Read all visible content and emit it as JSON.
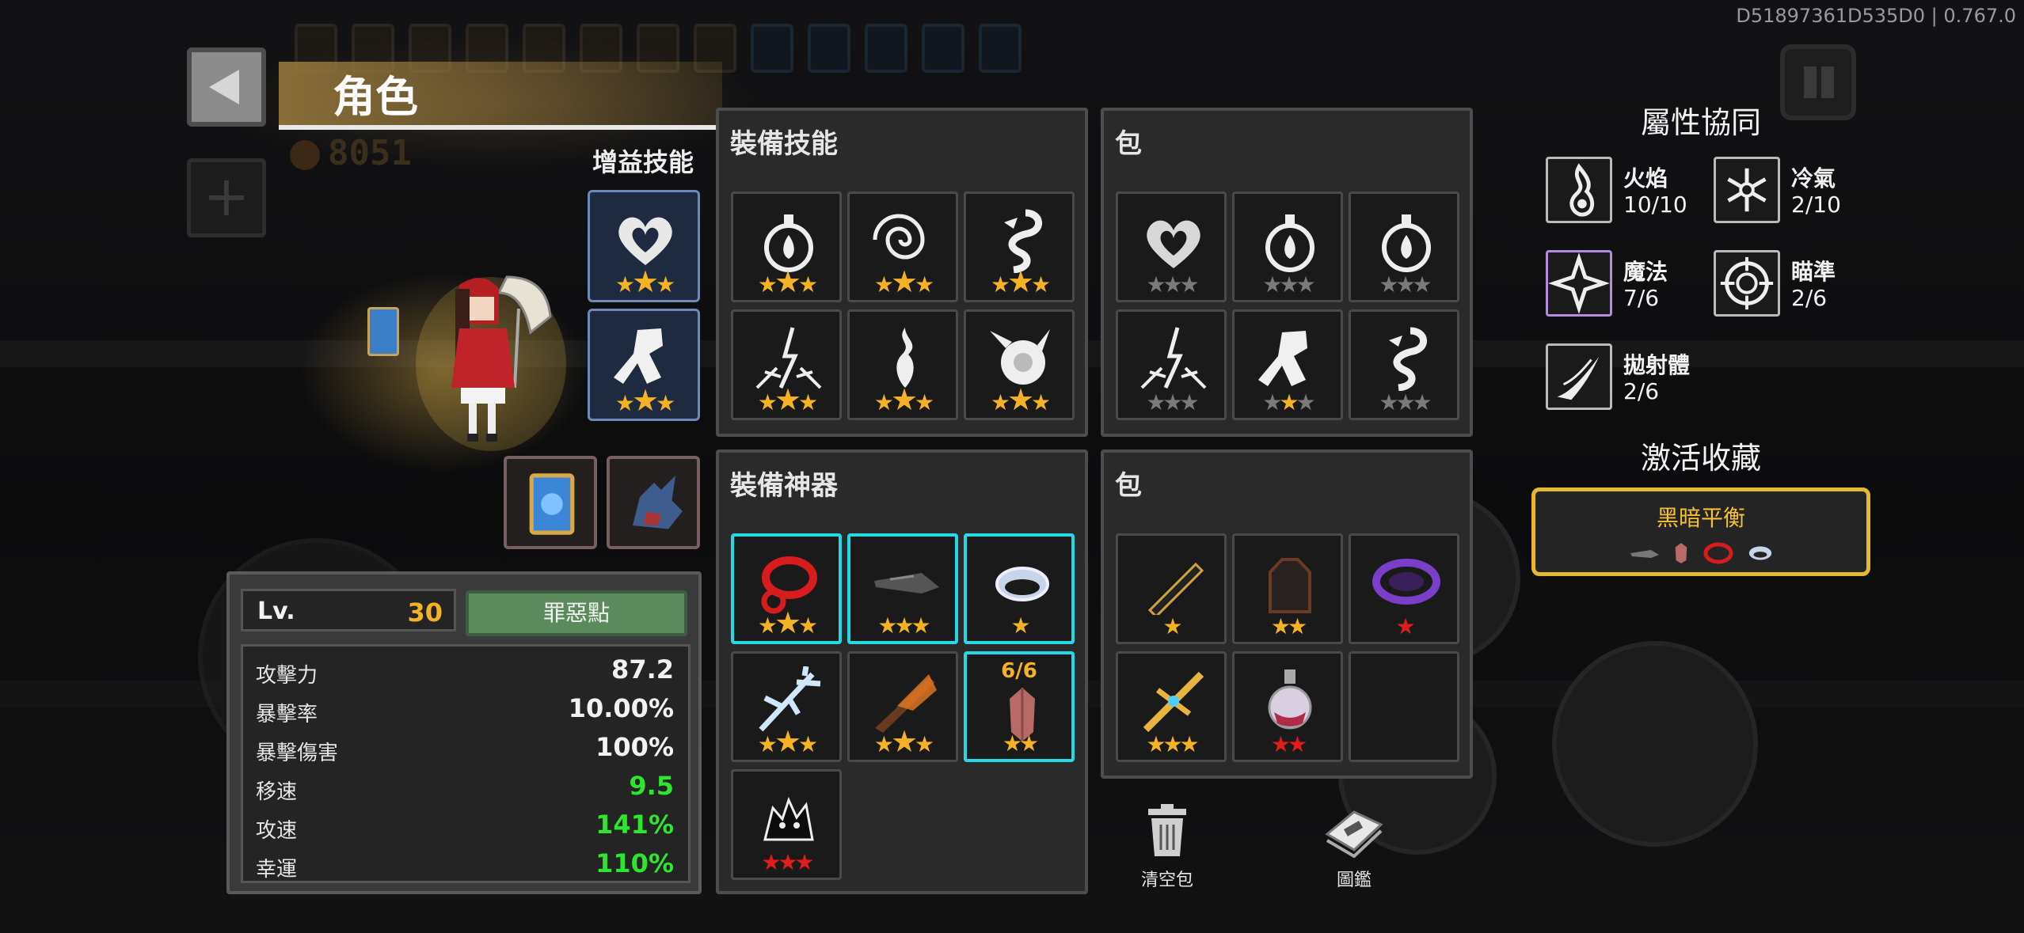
{
  "version": "D51897361D535D0 | 0.767.0",
  "header": {
    "title": "角色",
    "coins": "8051"
  },
  "buff": {
    "label": "增益技能",
    "slots": [
      {
        "icon": "heart-flame-icon",
        "stars": 3,
        "lit": 3
      },
      {
        "icon": "thrower-figure-icon",
        "stars": 3,
        "lit": 3
      }
    ]
  },
  "stats": {
    "lv_label": "Lv.",
    "lv_value": "30",
    "sin_button": "罪惡點",
    "rows": [
      {
        "name": "攻擊力",
        "value": "87.2",
        "color": "white"
      },
      {
        "name": "暴擊率",
        "value": "10.00%",
        "color": "white"
      },
      {
        "name": "暴擊傷害",
        "value": "100%",
        "color": "white"
      },
      {
        "name": "移速",
        "value": "9.5",
        "color": "green"
      },
      {
        "name": "攻速",
        "value": "141%",
        "color": "green"
      },
      {
        "name": "幸運",
        "value": "110%",
        "color": "green"
      }
    ]
  },
  "equip_skills": {
    "title": "裝備技能",
    "slots": [
      {
        "icon": "potion-flame-icon",
        "stars": "gold3"
      },
      {
        "icon": "vortex-icon",
        "stars": "gold3"
      },
      {
        "icon": "serpent-icon",
        "stars": "gold3"
      },
      {
        "icon": "lightning-burst-icon",
        "stars": "gold3"
      },
      {
        "icon": "fire-pillar-icon",
        "stars": "gold3"
      },
      {
        "icon": "fireball-icon",
        "stars": "gold3"
      }
    ]
  },
  "skill_bag": {
    "title": "包",
    "slots": [
      {
        "icon": "heart-flame-icon",
        "stars": "gray3"
      },
      {
        "icon": "potion-flame-icon",
        "stars": "gray3"
      },
      {
        "icon": "potion-flame-icon",
        "stars": "gray3"
      },
      {
        "icon": "lightning-burst-icon",
        "stars": "gray3"
      },
      {
        "icon": "thrower-figure-icon",
        "stars": "gold1gray2"
      },
      {
        "icon": "serpent-icon",
        "stars": "gray3"
      }
    ]
  },
  "equip_artifacts": {
    "title": "裝備神器",
    "count_label": "6/6",
    "slots": [
      {
        "icon": "red-ring-icon",
        "stars": "gold3"
      },
      {
        "icon": "dark-dagger-icon",
        "stars": "gold3"
      },
      {
        "icon": "silver-ring-icon",
        "stars": "gold1"
      },
      {
        "icon": "ice-staff-icon",
        "stars": "gold3"
      },
      {
        "icon": "flame-sword-icon",
        "stars": "gold3"
      },
      {
        "icon": "crystal-icon",
        "stars": "gold2"
      },
      {
        "icon": "shadow-beast-icon",
        "stars": "red3"
      }
    ]
  },
  "artifact_bag": {
    "title": "包",
    "slots": [
      {
        "icon": "pen-icon",
        "stars": "gold1"
      },
      {
        "icon": "dark-glove-icon",
        "stars": "gold2"
      },
      {
        "icon": "purple-ring-icon",
        "stars": "red1"
      },
      {
        "icon": "golden-cross-icon",
        "stars": "gold3"
      },
      {
        "icon": "potion-bottle-icon",
        "stars": "red2"
      }
    ]
  },
  "actions": {
    "clear": "清空包",
    "codex": "圖鑑"
  },
  "synergy": {
    "title": "屬性協同",
    "items": [
      {
        "icon": "fire-icon",
        "name": "火焰",
        "value": "10/10"
      },
      {
        "icon": "snowflake-icon",
        "name": "冷氣",
        "value": "2/10"
      },
      {
        "icon": "magic-star-icon",
        "name": "魔法",
        "value": "7/6"
      },
      {
        "icon": "crosshair-icon",
        "name": "瞄準",
        "value": "2/6"
      },
      {
        "icon": "projectile-icon",
        "name": "拋射體",
        "value": "2/6"
      }
    ]
  },
  "collection": {
    "title": "激活收藏",
    "name": "黑暗平衡",
    "icons": [
      "dark-dagger-icon",
      "crystal-icon",
      "red-ring-icon",
      "silver-ring-icon"
    ]
  },
  "colors": {
    "gold": "#f5b324",
    "cyan": "#24d9e6",
    "green": "#2ee62e",
    "collection_border": "#e6b832"
  }
}
